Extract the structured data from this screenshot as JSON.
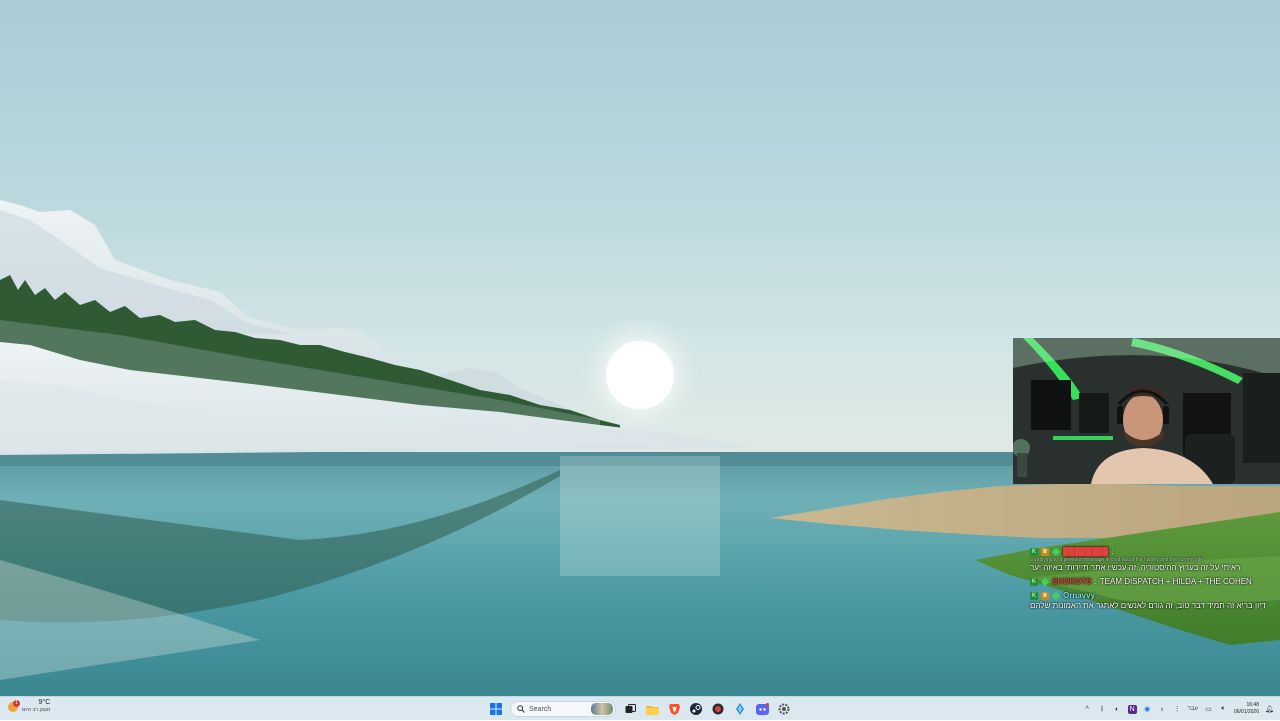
{
  "taskbar": {
    "weather": {
      "temperature": "9°C",
      "description": "מעונן רב היום",
      "alert_count": "1"
    },
    "search": {
      "placeholder": "Search"
    },
    "pinned_apps": [
      "start-icon",
      "search-box",
      "task-view-icon",
      "file-explorer-icon",
      "brave-browser-icon",
      "steam-icon",
      "app-red-icon",
      "feather-app-icon",
      "discord-icon",
      "settings-icon"
    ],
    "tray": {
      "language": "עבר",
      "time": "16:48",
      "date": "06/01/2026"
    }
  },
  "chat": {
    "messages": [
      {
        "username": "████████",
        "username_color": "#e0413b",
        "badges": [
          "green",
          "gold",
          "diamond"
        ],
        "hint": "is replying to a previous message in chat about the history and the current site",
        "text": "ראיתי על זה בערוץ ההיסטוריה, זה עכשיו אתר תיירותי באיזה יער"
      },
      {
        "username": "SHOKOTS",
        "username_color": "#e0413b",
        "badges": [
          "green",
          "diamond"
        ],
        "text": "TEAM DISPATCH + HILDA + THE COHEN"
      },
      {
        "username": "Ornavvy",
        "username_color": "#7fe0d6",
        "badges": [
          "green",
          "gold",
          "diamond"
        ],
        "text": "דיון בריא זה תמיד דבר טוב, זה גורם לאנשים לאתגר את האמונות שלהם"
      }
    ]
  },
  "colors": {
    "taskbar_bg": "#dce8f0",
    "accent_blue": "#1a73e8"
  }
}
